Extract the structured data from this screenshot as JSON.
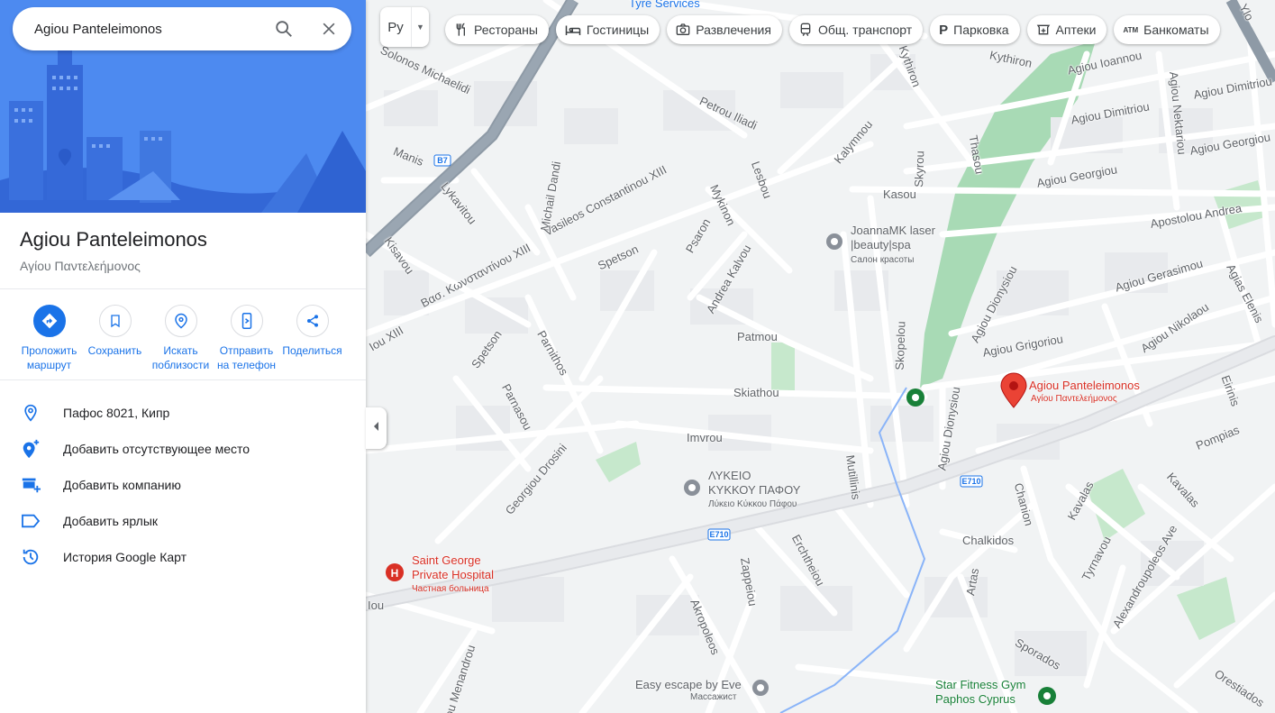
{
  "search": {
    "query": "Agiou Panteleimonos"
  },
  "place": {
    "title": "Agiou Panteleimonos",
    "subtitle": "Αγίου Παντελεήμονος"
  },
  "actions": [
    {
      "label": "Проложить маршрут",
      "icon": "directions-icon"
    },
    {
      "label": "Сохранить",
      "icon": "bookmark-icon"
    },
    {
      "label": "Искать поблизости",
      "icon": "nearby-search-icon"
    },
    {
      "label": "Отправить на телефон",
      "icon": "send-to-phone-icon"
    },
    {
      "label": "Поделиться",
      "icon": "share-icon"
    }
  ],
  "info_rows": [
    {
      "text": "Пафос 8021, Кипр",
      "icon": "location-pin-icon"
    },
    {
      "text": "Добавить отсутствующее место",
      "icon": "add-place-icon"
    },
    {
      "text": "Добавить компанию",
      "icon": "add-business-icon"
    },
    {
      "text": "Добавить ярлык",
      "icon": "label-icon"
    },
    {
      "text": "История Google Карт",
      "icon": "history-icon"
    }
  ],
  "map": {
    "layer_button": "Ру",
    "chips": [
      {
        "label": "Рестораны",
        "icon": "restaurant-icon"
      },
      {
        "label": "Гостиницы",
        "icon": "hotel-icon"
      },
      {
        "label": "Развлечения",
        "icon": "camera-icon"
      },
      {
        "label": "Общ. транспорт",
        "icon": "transit-icon"
      },
      {
        "label": "Парковка",
        "icon": "parking-icon"
      },
      {
        "label": "Аптеки",
        "icon": "pharmacy-icon"
      },
      {
        "label": "Банкоматы",
        "icon": "atm-icon"
      }
    ],
    "pois": {
      "selected": {
        "name": "Agiou Panteleimonos",
        "sub": "Αγίου Παντελεήμονος"
      },
      "joanna": {
        "name1": "JoannaMK laser",
        "name2": "|beauty|spa",
        "sub": "Салон красоты"
      },
      "lykeio": {
        "name1": "ΛΥΚΕΙΟ",
        "name2": "ΚΥΚΚΟΥ ΠΑΦΟΥ",
        "sub": "Лύκειο Κύκκου Πάφου"
      },
      "hospital": {
        "name1": "Saint George",
        "name2": "Private Hospital",
        "sub": "Частная больница"
      },
      "easy": {
        "name": "Easy escape by Eve",
        "sub": "Массажист"
      },
      "star": {
        "name1": "Star Fitness Gym",
        "name2": "Paphos Cyprus"
      },
      "tyre": {
        "name": "Tyre Services"
      }
    },
    "road_shields": [
      "B7",
      "E710",
      "E710"
    ],
    "streets": [
      "Solonos Michaelidi",
      "Petrou Iliadi",
      "Kythiron",
      "Agiou Ioannou",
      "Kythiron",
      "Agiou Dimitriou",
      "Agiou Dimitriou",
      "Agiou Nektariou",
      "Agiou Georgiou",
      "Agiou Georgiou",
      "Manis",
      "Kalymnou",
      "Thasou",
      "Skyrou",
      "Kasou",
      "Lesbou",
      "Lykavitou",
      "Michail Dandi",
      "Vasileos Constantinou XIII",
      "Mykinon",
      "Kisavou",
      "Βασ. Κωνσταντίνου XIII",
      "Spetson",
      "Psaron",
      "Andrea Kalvou",
      "Apostolou Andrea",
      "Agiou Gerasimou",
      "Agias Elenis",
      "Agiou Dionysiou",
      "Agiou Grigoriou",
      "Agiou Nikolaou",
      "Patmou",
      "Spetson",
      "Parnithos",
      "Skopelou",
      "Skiathou",
      "Parnasou",
      "Imvrou",
      "Agiou Dionysiou",
      "Eirinis",
      "Pompias",
      "Georgiou Drosini",
      "Mutillinis",
      "Chanion",
      "Kavalas",
      "Kavalas",
      "Chalkidos",
      "Erchtheiou",
      "Zappeiou",
      "Tyrnavou",
      "Alexandroupoleos Ave",
      "Artas",
      "Akropoleos",
      "Sporados",
      "Orestiados",
      "Iou Menandrou",
      "Iou",
      "Iou XIII",
      "Ylo"
    ]
  }
}
